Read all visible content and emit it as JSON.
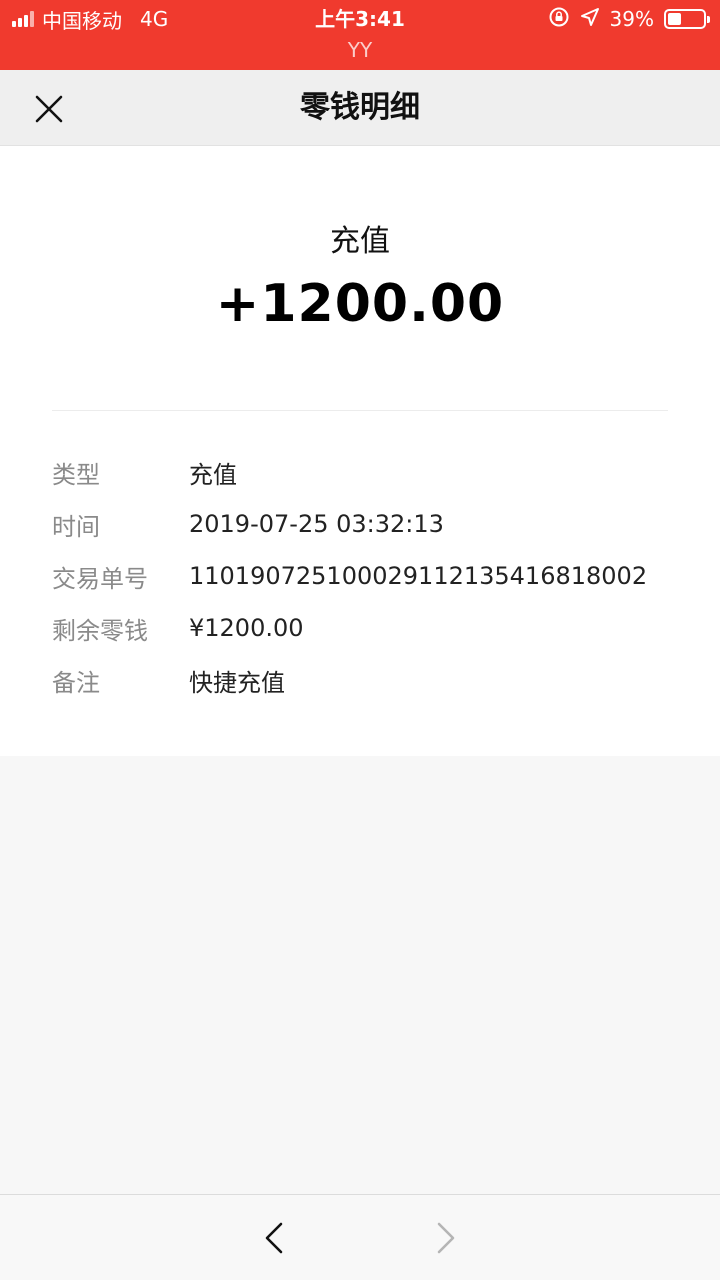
{
  "status_bar": {
    "carrier": "中国移动",
    "network": "4G",
    "time": "上午3:41",
    "subtitle": "YY",
    "battery_percent": "39%",
    "battery_level": 0.39
  },
  "navbar": {
    "title": "零钱明细"
  },
  "detail": {
    "type_label": "充值",
    "amount": "+1200.00",
    "rows": [
      {
        "key": "类型",
        "value": "充值"
      },
      {
        "key": "时间",
        "value": "2019-07-25 03:32:13"
      },
      {
        "key": "交易单号",
        "value": "110190725100029112135416818002"
      },
      {
        "key": "剩余零钱",
        "value": "¥1200.00"
      },
      {
        "key": "备注",
        "value": "快捷充值"
      }
    ]
  },
  "colors": {
    "status_bar_bg": "#f03a2e",
    "navbar_bg": "#efefef"
  },
  "icons": {
    "close": "close-icon",
    "back": "chevron-left-icon",
    "forward": "chevron-right-icon"
  }
}
